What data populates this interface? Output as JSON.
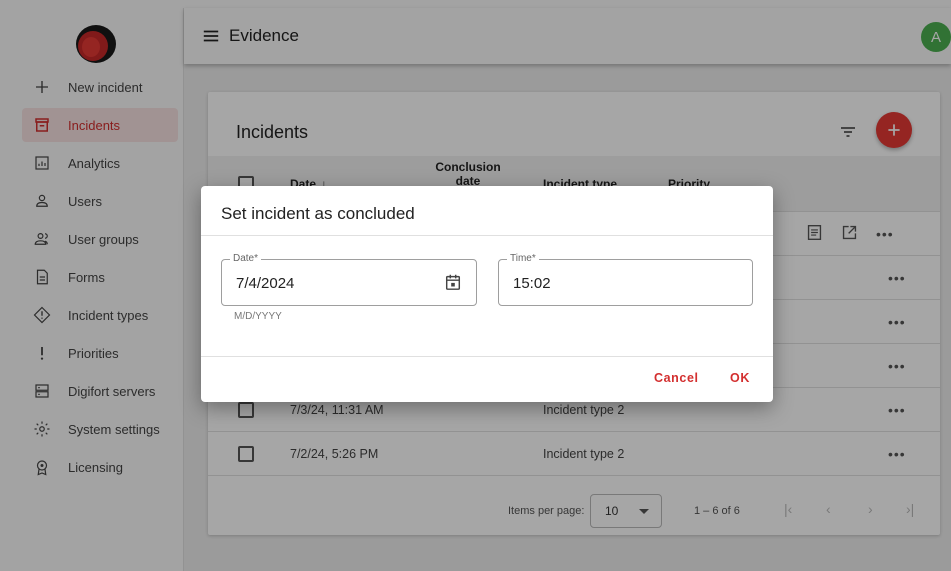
{
  "app": {
    "title": "Evidence",
    "avatar_initial": "A",
    "accent_color": "#d32f2f",
    "avatar_color": "#4caf50"
  },
  "sidebar": {
    "items": [
      {
        "label": "New incident",
        "icon": "plus-icon"
      },
      {
        "label": "Incidents",
        "icon": "incidents-icon",
        "active": true
      },
      {
        "label": "Analytics",
        "icon": "analytics-icon"
      },
      {
        "label": "Users",
        "icon": "user-icon"
      },
      {
        "label": "User groups",
        "icon": "user-groups-icon"
      },
      {
        "label": "Forms",
        "icon": "form-icon"
      },
      {
        "label": "Incident types",
        "icon": "alert-diamond-icon"
      },
      {
        "label": "Priorities",
        "icon": "exclamation-icon"
      },
      {
        "label": "Digifort servers",
        "icon": "server-icon"
      },
      {
        "label": "System settings",
        "icon": "gear-icon"
      },
      {
        "label": "Licensing",
        "icon": "license-badge-icon"
      }
    ]
  },
  "incidents": {
    "title": "Incidents",
    "columns": {
      "date": "Date",
      "conclusion": "Conclusion date",
      "type": "Incident type",
      "priority": "Priority"
    },
    "rows": [
      {
        "date": "7/3/24, 11:31 AM",
        "type": "Incident type 2",
        "priority": ""
      },
      {
        "date": "7/2/24, 5:26 PM",
        "type": "Incident type 2",
        "priority": ""
      }
    ],
    "paginator": {
      "items_per_page_label": "Items per page:",
      "page_size": "10",
      "range": "1 – 6 of 6"
    }
  },
  "dialog": {
    "title": "Set incident as concluded",
    "date": {
      "label": "Date*",
      "value": "7/4/2024",
      "hint": "M/D/YYYY"
    },
    "time": {
      "label": "Time*",
      "value": "15:02"
    },
    "cancel_label": "Cancel",
    "ok_label": "OK"
  }
}
